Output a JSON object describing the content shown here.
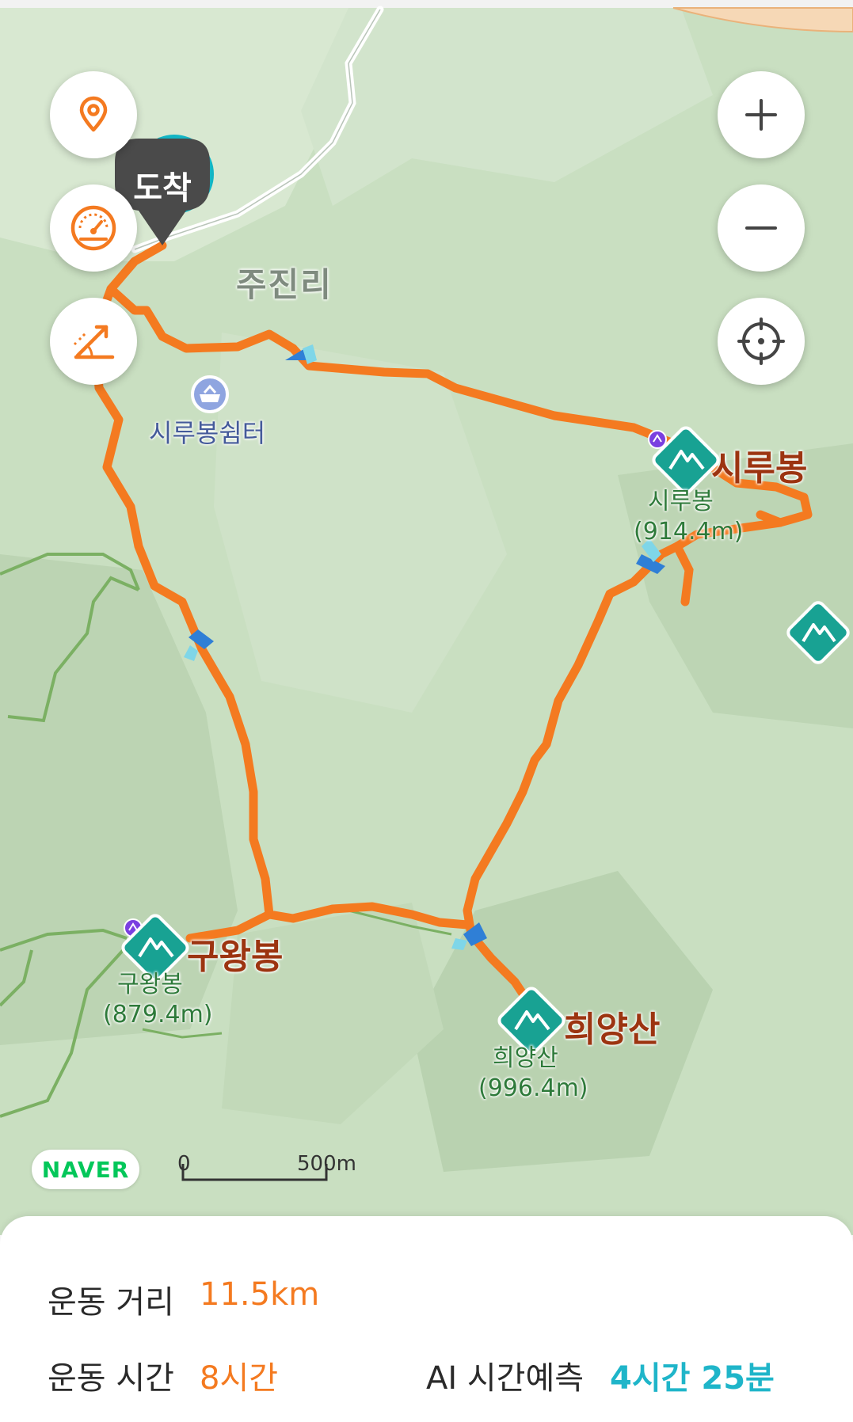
{
  "map": {
    "arrival_label": "도착",
    "village_label": "주진리",
    "shelter_label": "시루봉쉼터",
    "brand": "NAVER",
    "scale": {
      "start": "0",
      "end": "500m"
    },
    "route_color": "#f47a20",
    "peaks": [
      {
        "name": "시루봉",
        "sub_name": "시루봉",
        "elevation": "(914.4m)"
      },
      {
        "name": "구왕봉",
        "sub_name": "구왕봉",
        "elevation": "(879.4m)"
      },
      {
        "name": "희양산",
        "sub_name": "희양산",
        "elevation": "(996.4m)"
      }
    ],
    "controls": {
      "left": [
        "location-pin-icon",
        "speedometer-icon",
        "slope-icon"
      ],
      "right": [
        "zoom-in-icon",
        "zoom-out-icon",
        "crosshair-icon"
      ]
    }
  },
  "stats": {
    "distance_label": "운동 거리",
    "distance_value": "11.5km",
    "time_label": "운동 시간",
    "time_value": "8시간",
    "ai_label": "AI 시간예측",
    "ai_value": "4시간 25분",
    "accent_color": "#f47a20",
    "ai_color": "#1fb5c9"
  }
}
